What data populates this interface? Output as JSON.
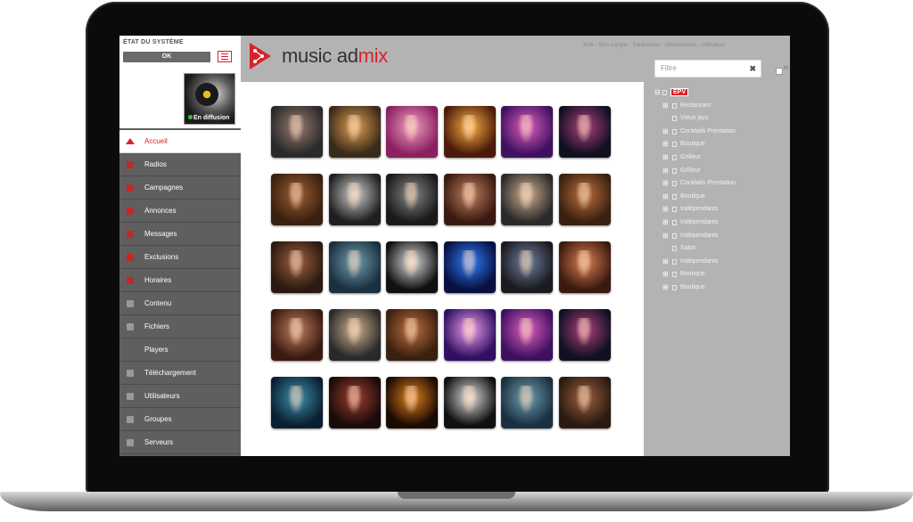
{
  "colors": {
    "accent": "#d8232a",
    "sidebar": "#5f5f5f",
    "panel": "#b3b3b3"
  },
  "status": {
    "title": "ÉTAT DU SYSTÈME",
    "state": "OK",
    "live_label": "En diffusion"
  },
  "brand": {
    "name_primary": "music ad",
    "name_accent": "mix"
  },
  "header": {
    "links": "Aide · Mon compte · Paramètres · Déconnexion · Utilisateur"
  },
  "nav": [
    {
      "label": "Accueil",
      "icon": "home-icon",
      "active": true
    },
    {
      "label": "Radios",
      "icon": "radio-icon"
    },
    {
      "label": "Campagnes",
      "icon": "campaign-icon"
    },
    {
      "label": "Annonces",
      "icon": "announce-icon"
    },
    {
      "label": "Messages",
      "icon": "message-icon"
    },
    {
      "label": "Exclusions",
      "icon": "exclusion-icon"
    },
    {
      "label": "Horaires",
      "icon": "clock-icon"
    },
    {
      "label": "Contenu",
      "icon": "pencil-icon"
    },
    {
      "label": "Fichiers",
      "icon": "file-icon"
    },
    {
      "label": "Players",
      "icon": "player-icon"
    },
    {
      "label": "Téléchargement",
      "icon": "download-icon"
    },
    {
      "label": "Utilisateurs",
      "icon": "user-icon"
    },
    {
      "label": "Groupes",
      "icon": "group-icon"
    },
    {
      "label": "Serveurs",
      "icon": "server-icon"
    }
  ],
  "filter": {
    "placeholder": "Filtre",
    "clear_icon": "close-icon",
    "check_label": "M"
  },
  "tree": {
    "root": "EPV",
    "items": [
      {
        "label": "Restaurant",
        "leaf": false
      },
      {
        "label": "Vieux jazz",
        "leaf": true
      },
      {
        "label": "Cocktails Prestation",
        "leaf": false
      },
      {
        "label": "Boutique",
        "leaf": false
      },
      {
        "label": "Grilleur",
        "leaf": false
      },
      {
        "label": "Grilleur",
        "leaf": false
      },
      {
        "label": "Cocktails Prestation",
        "leaf": false
      },
      {
        "label": "Boutique",
        "leaf": false
      },
      {
        "label": "Indépendants",
        "leaf": false
      },
      {
        "label": "Indépendants",
        "leaf": false
      },
      {
        "label": "Indépendants",
        "leaf": false
      },
      {
        "label": "Salon",
        "leaf": true
      },
      {
        "label": "Indépendants",
        "leaf": false
      },
      {
        "label": "Boutique",
        "leaf": false
      },
      {
        "label": "Boutique",
        "leaf": false
      }
    ]
  },
  "tiles": [
    {
      "name": "singer-microphone",
      "c1": "#2a2a2a",
      "c2": "#9a7a70"
    },
    {
      "name": "band-stage",
      "c1": "#3a2a1a",
      "c2": "#e0a050"
    },
    {
      "name": "singer-pink",
      "c1": "#8a2060",
      "c2": "#f0a0c0"
    },
    {
      "name": "concert-crowd",
      "c1": "#4a1a0a",
      "c2": "#ffb040"
    },
    {
      "name": "dj-purple",
      "c1": "#401060",
      "c2": "#e060c0"
    },
    {
      "name": "headphones-neon",
      "c1": "#101020",
      "c2": "#b04080"
    },
    {
      "name": "whisky-glass",
      "c1": "#3a2010",
      "c2": "#a06030"
    },
    {
      "name": "singer-bw",
      "c1": "#202020",
      "c2": "#d0d0d0"
    },
    {
      "name": "singer-cap",
      "c1": "#1a1a1a",
      "c2": "#888888"
    },
    {
      "name": "guitar-duo",
      "c1": "#3a1a10",
      "c2": "#c08060"
    },
    {
      "name": "blonde-singer",
      "c1": "#2a2a2a",
      "c2": "#d0b090"
    },
    {
      "name": "guitarist-woman",
      "c1": "#3a2010",
      "c2": "#c07040"
    },
    {
      "name": "diva-singer",
      "c1": "#2a1a10",
      "c2": "#a06040"
    },
    {
      "name": "singer-blue",
      "c1": "#1a3040",
      "c2": "#70a0b0"
    },
    {
      "name": "piano-keys",
      "c1": "#101010",
      "c2": "#e0e0e0"
    },
    {
      "name": "blue-ring",
      "c1": "#081040",
      "c2": "#3080ff"
    },
    {
      "name": "hat-singer",
      "c1": "#1a1a20",
      "c2": "#7080a0"
    },
    {
      "name": "duo-singers",
      "c1": "#3a1a10",
      "c2": "#e08050"
    },
    {
      "name": "guitar-duo-2",
      "c1": "#3a1a10",
      "c2": "#c08060"
    },
    {
      "name": "blonde-singer-2",
      "c1": "#2a2a2a",
      "c2": "#d0b090"
    },
    {
      "name": "guitarist-woman-2",
      "c1": "#3a2010",
      "c2": "#c07040"
    },
    {
      "name": "light-burst",
      "c1": "#301060",
      "c2": "#f0a0f0"
    },
    {
      "name": "dj-purple-2",
      "c1": "#401060",
      "c2": "#e060c0"
    },
    {
      "name": "headphones-neon-2",
      "c1": "#101020",
      "c2": "#b04080"
    },
    {
      "name": "band-blue",
      "c1": "#0a2030",
      "c2": "#4090b0"
    },
    {
      "name": "hat-singer-red",
      "c1": "#1a0a0a",
      "c2": "#a04030"
    },
    {
      "name": "orange-ring",
      "c1": "#1a0a00",
      "c2": "#e08020"
    },
    {
      "name": "piano-keys-2",
      "c1": "#101010",
      "c2": "#e0e0e0"
    },
    {
      "name": "singer-blue-2",
      "c1": "#1a3040",
      "c2": "#70a0b0"
    },
    {
      "name": "diva-singer-2",
      "c1": "#2a1a10",
      "c2": "#a06040"
    }
  ]
}
